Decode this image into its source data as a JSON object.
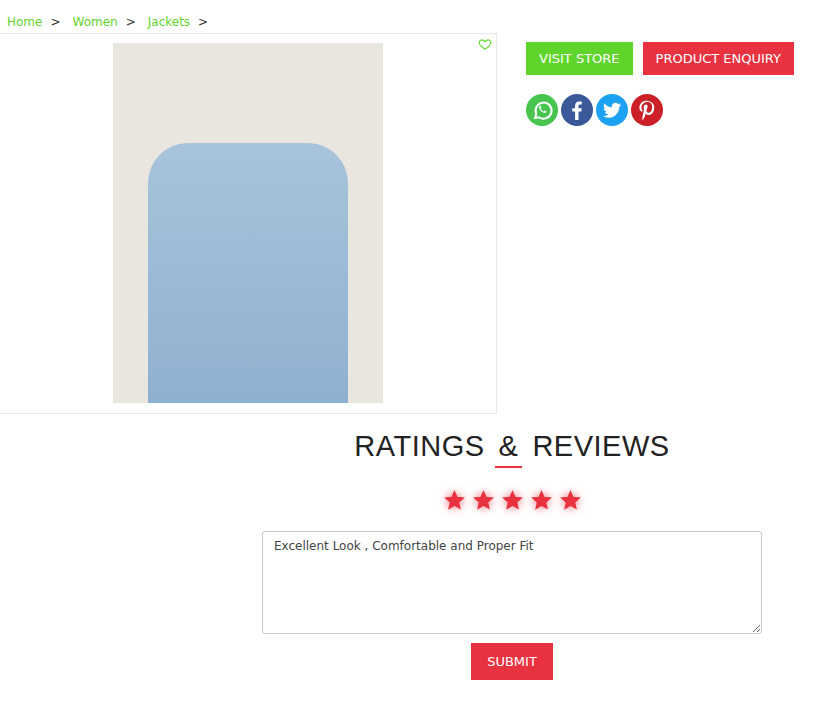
{
  "breadcrumb": {
    "items": [
      "Home",
      "Women",
      "Jackets"
    ],
    "separator": ">"
  },
  "product": {
    "favorite": false
  },
  "actions": [
    {
      "label": "VISIT STORE",
      "color": "#5fd52b"
    },
    {
      "label": "PRODUCT ENQUIRY",
      "color": "#e8323f"
    }
  ],
  "social": [
    {
      "kind": "whatsapp",
      "color": "#47c54f"
    },
    {
      "kind": "facebook",
      "color": "#3b5998"
    },
    {
      "kind": "twitter",
      "color": "#1da1f2"
    },
    {
      "kind": "pinterest",
      "color": "#cb2027"
    }
  ],
  "reviews": {
    "heading": [
      {
        "text": "RATINGS",
        "accent": false
      },
      {
        "text": "&",
        "accent": true
      },
      {
        "text": "REVIEWS",
        "accent": false
      }
    ],
    "rating": {
      "stars": 5,
      "max": 5
    },
    "text": "Excellent Look , Comfortable and Proper Fit",
    "submit": "SUBMIT"
  }
}
